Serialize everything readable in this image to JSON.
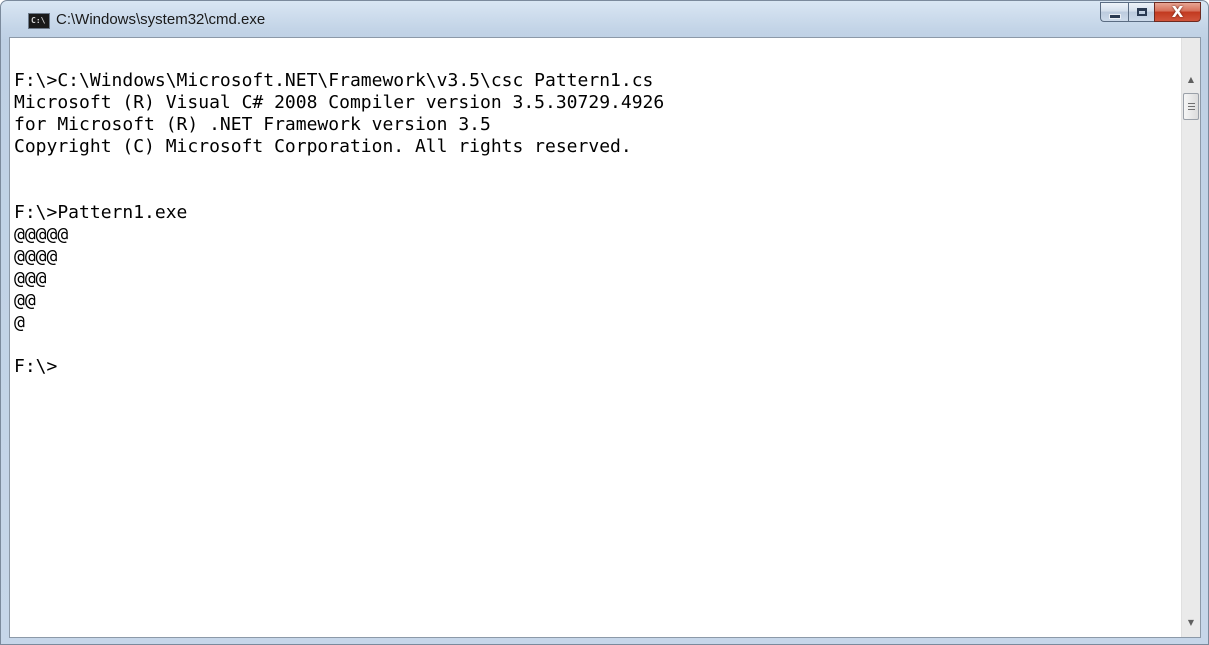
{
  "window": {
    "title": "C:\\Windows\\system32\\cmd.exe",
    "icon": "cmd-icon",
    "icon_text": "C:\\"
  },
  "caption_buttons": {
    "minimize": "minimize-icon",
    "maximize": "maximize-icon",
    "close": "close-icon",
    "close_glyph": "X"
  },
  "console": {
    "lines": [
      "F:\\>C:\\Windows\\Microsoft.NET\\Framework\\v3.5\\csc Pattern1.cs",
      "Microsoft (R) Visual C# 2008 Compiler version 3.5.30729.4926",
      "for Microsoft (R) .NET Framework version 3.5",
      "Copyright (C) Microsoft Corporation. All rights reserved.",
      "",
      "",
      "F:\\>Pattern1.exe",
      "@@@@@",
      "@@@@",
      "@@@",
      "@@",
      "@",
      "",
      "F:\\>"
    ]
  },
  "scrollbar": {
    "up_glyph": "▲",
    "down_glyph": "▼"
  },
  "colors": {
    "console_background": "#ffffff",
    "console_text": "#000000",
    "close_button": "#c2391f"
  }
}
